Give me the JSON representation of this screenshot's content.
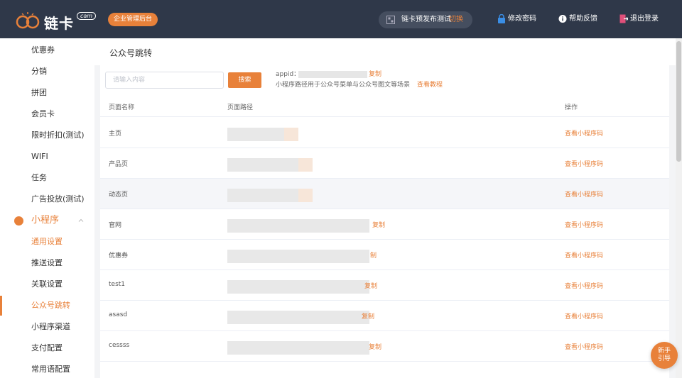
{
  "header": {
    "brand": "链卡",
    "brand_badge": "cam",
    "admin_label": "企业管理后台",
    "env_label": "链卡预发布测试",
    "env_switch": "切换",
    "change_password": "修改密码",
    "help": "帮助反馈",
    "logout": "退出登录"
  },
  "sidebar": {
    "items": [
      {
        "label": "优惠券"
      },
      {
        "label": "分销"
      },
      {
        "label": "拼团"
      },
      {
        "label": "会员卡"
      },
      {
        "label": "限时折扣(测试)"
      },
      {
        "label": "WIFI"
      },
      {
        "label": "任务"
      },
      {
        "label": "广告投放(测试)"
      }
    ],
    "group": {
      "label": "小程序"
    },
    "sub_items": [
      {
        "label": "通用设置"
      },
      {
        "label": "推送设置"
      },
      {
        "label": "关联设置"
      },
      {
        "label": "公众号跳转"
      },
      {
        "label": "小程序渠道"
      },
      {
        "label": "支付配置"
      },
      {
        "label": "常用语配置"
      }
    ]
  },
  "page": {
    "title": "公众号跳转",
    "search_placeholder": "请输入内容",
    "search_button": "搜索",
    "appid_label": "appid：",
    "copy_label": "复制",
    "hint": "小程序路径用于公众号菜单与公众号图文等场景",
    "hint_link": "查看教程"
  },
  "table": {
    "columns": [
      "页面名称",
      "页面路径",
      "操作"
    ],
    "rows": [
      {
        "name": "主页",
        "copy": "",
        "action": "查看小程序码"
      },
      {
        "name": "产品页",
        "copy": "",
        "action": "查看小程序码"
      },
      {
        "name": "动态页",
        "copy": "",
        "action": "查看小程序码"
      },
      {
        "name": "官网",
        "copy": "复制",
        "action": "查看小程序码"
      },
      {
        "name": "优惠券",
        "copy": "制",
        "action": "查看小程序码"
      },
      {
        "name": "test1",
        "copy": "复制",
        "action": "查看小程序码"
      },
      {
        "name": "asasd",
        "copy": "复制",
        "action": "查看小程序码"
      },
      {
        "name": "cessss",
        "copy": "复制",
        "action": "查看小程序码"
      }
    ]
  },
  "guide": {
    "line1": "新手",
    "line2": "引导"
  },
  "colors": {
    "accent": "#e8813a",
    "topbar": "#2f3849"
  }
}
